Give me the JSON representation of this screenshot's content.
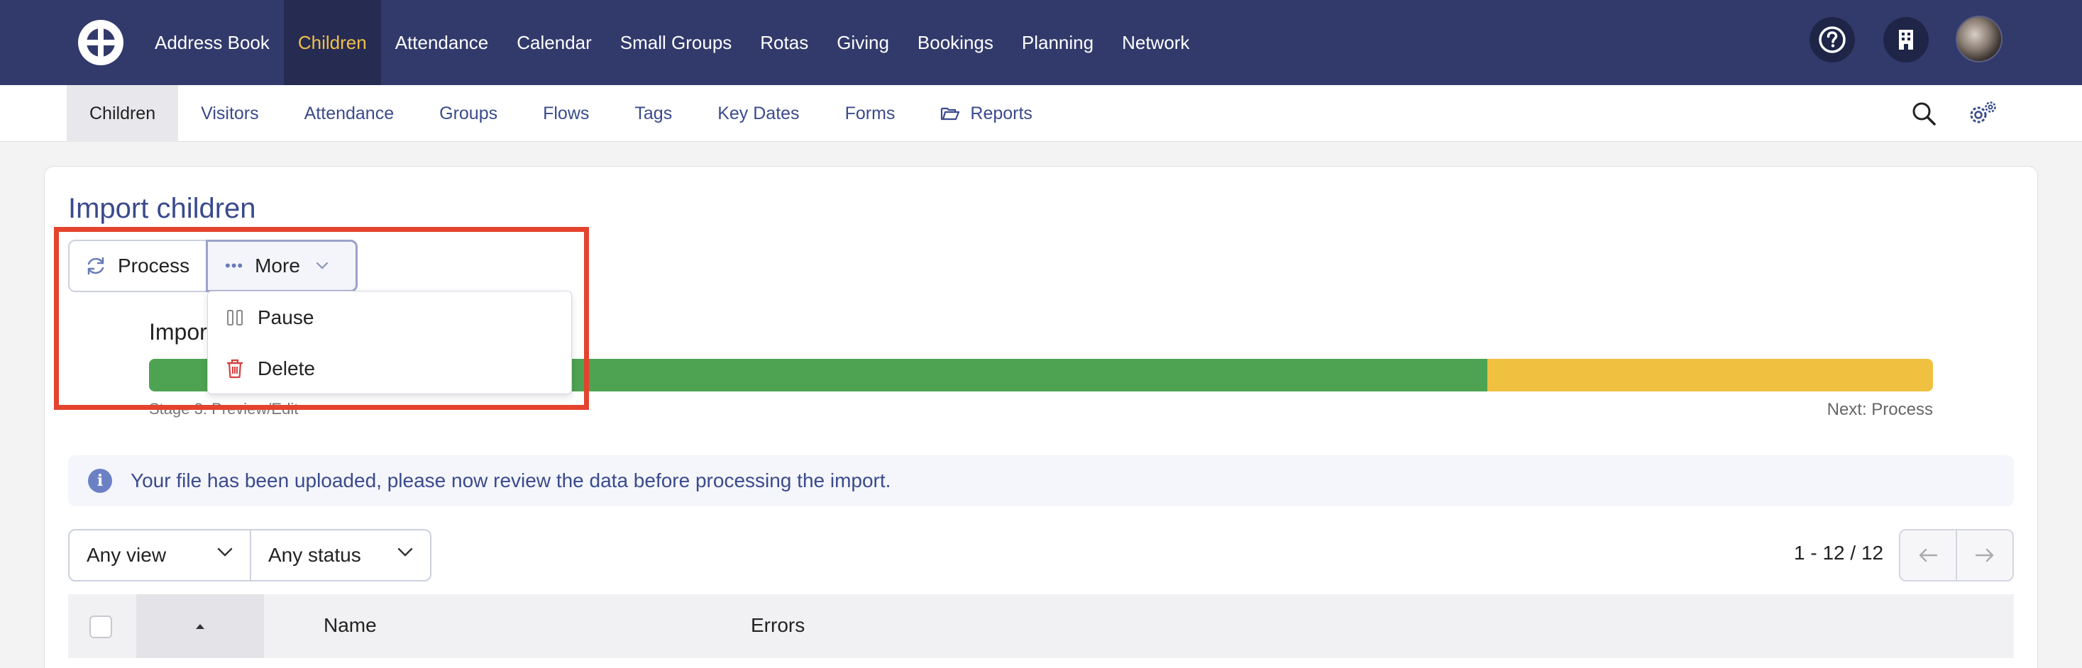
{
  "topnav": {
    "items": [
      "Address Book",
      "Children",
      "Attendance",
      "Calendar",
      "Small Groups",
      "Rotas",
      "Giving",
      "Bookings",
      "Planning",
      "Network"
    ],
    "active": "Children"
  },
  "subnav": {
    "items": [
      "Children",
      "Visitors",
      "Attendance",
      "Groups",
      "Flows",
      "Tags",
      "Key Dates",
      "Forms",
      "Reports"
    ],
    "active": "Children"
  },
  "page": {
    "title": "Import children",
    "process_label": "Process",
    "more_label": "More",
    "import_label": "Impor",
    "stage_label": "Stage 3: Preview/Edit",
    "next_label": "Next: Process",
    "progress_fraction": 0.75
  },
  "dropdown": {
    "pause_label": "Pause",
    "delete_label": "Delete"
  },
  "alert": {
    "message": "Your file has been uploaded, please now review the data before processing the import."
  },
  "filters": {
    "view": "Any view",
    "status": "Any status"
  },
  "pager": {
    "text": "1 - 12 / 12"
  },
  "table": {
    "columns": [
      "Name",
      "Errors"
    ]
  },
  "colors": {
    "nav_bg": "#323a6b",
    "nav_active": "#f1c04a",
    "accent": "#3a4a8c",
    "progress_done": "#4ea352",
    "progress_rest": "#f0c141",
    "highlight": "#e4432d",
    "delete_red": "#d64040"
  },
  "icons": [
    "logo-icon",
    "help-icon",
    "building-icon",
    "search-icon",
    "settings-icon",
    "folder-icon",
    "refresh-icon",
    "more-dots-icon",
    "chevron-down-icon",
    "pause-icon",
    "trash-icon",
    "info-icon",
    "arrow-left-icon",
    "arrow-right-icon",
    "sort-up-icon"
  ]
}
